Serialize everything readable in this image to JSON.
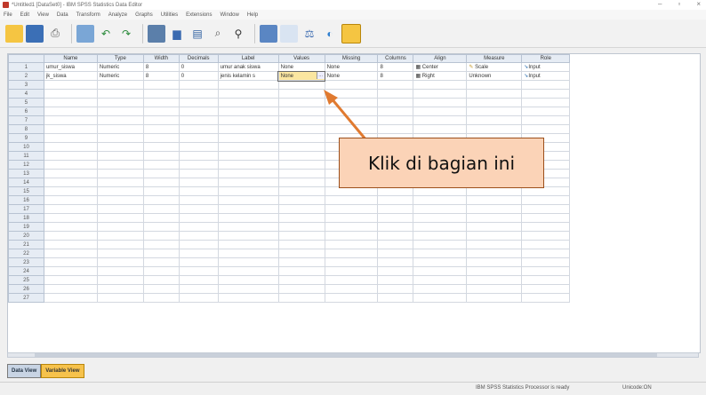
{
  "window": {
    "title": "*Untitled1 [DataSet0] - IBM SPSS Statistics Data Editor",
    "controls": [
      "–",
      "▫",
      "×"
    ]
  },
  "menu": [
    "File",
    "Edit",
    "View",
    "Data",
    "Transform",
    "Analyze",
    "Graphs",
    "Utilities",
    "Extensions",
    "Window",
    "Help"
  ],
  "toolbar_icons": [
    "open-icon",
    "save-icon",
    "print-icon",
    "dialog-recall-icon",
    "undo-icon",
    "redo-icon",
    "goto-case-icon",
    "goto-variable-icon",
    "variables-icon",
    "find-icon",
    "insert-cases-icon",
    "insert-variable-icon",
    "split-file-icon",
    "weight-cases-icon",
    "value-labels-icon"
  ],
  "columns": [
    "",
    "Name",
    "Type",
    "Width",
    "Decimals",
    "Label",
    "Values",
    "Missing",
    "Columns",
    "Align",
    "Measure",
    "Role"
  ],
  "rows": [
    {
      "num": "1",
      "cells": [
        "umur_siswa",
        "Numeric",
        "8",
        "0",
        "umur anak siswa",
        "None",
        "None",
        "8",
        "Center",
        "Scale",
        "Input"
      ]
    },
    {
      "num": "2",
      "cells": [
        "jk_siswa",
        "Numeric",
        "8",
        "0",
        "jenis kelamin s",
        "None",
        "None",
        "8",
        "Right",
        "Unknown",
        "Input"
      ]
    }
  ],
  "empty_row_numbers": [
    "3",
    "4",
    "5",
    "6",
    "7",
    "8",
    "9",
    "10",
    "11",
    "12",
    "13",
    "14",
    "15",
    "16",
    "17",
    "18",
    "19",
    "20",
    "21",
    "22",
    "23",
    "24",
    "25",
    "26",
    "27"
  ],
  "tabs": {
    "data_view": "Data View",
    "variable_view": "Variable View"
  },
  "status": {
    "processor": "IBM SPSS Statistics Processor is ready",
    "encoding": "Unicode:ON"
  },
  "callout": {
    "text": "Klik di bagian ini"
  },
  "colors": {
    "callout_fill": "#fbd3b7",
    "arrow": "#e07a30",
    "selected_cell": "#fbe6a0",
    "variable_tab": "#f6c24c"
  }
}
